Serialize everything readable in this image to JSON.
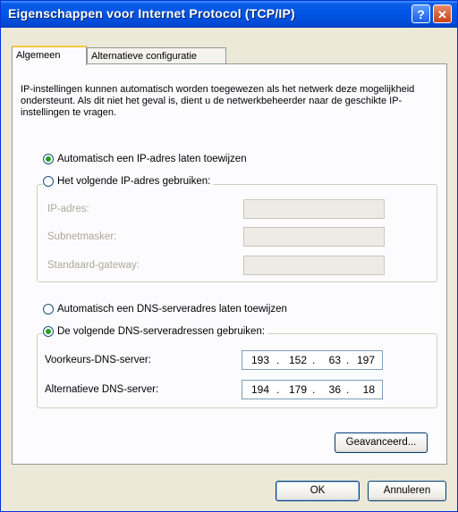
{
  "window": {
    "title": "Eigenschappen voor Internet Protocol (TCP/IP)",
    "help_glyph": "?",
    "close_glyph": "✕"
  },
  "tabs": [
    {
      "label": "Algemeen"
    },
    {
      "label": "Alternatieve configuratie"
    }
  ],
  "intro_text": "IP-instellingen kunnen automatisch worden toegewezen als het netwerk deze mogelijkheid ondersteunt. Als dit niet het geval is, dient u de netwerkbeheerder naar de geschikte IP-instellingen te vragen.",
  "ip": {
    "auto_label": "Automatisch een IP-adres laten toewijzen",
    "manual_label": "Het volgende IP-adres gebruiken:",
    "selected": "auto",
    "fields": [
      {
        "label": "IP-adres:",
        "value": ""
      },
      {
        "label": "Subnetmasker:",
        "value": ""
      },
      {
        "label": "Standaard-gateway:",
        "value": ""
      }
    ]
  },
  "dns": {
    "auto_label": "Automatisch een DNS-serveradres laten toewijzen",
    "manual_label": "De volgende DNS-serveradressen gebruiken:",
    "selected": "manual",
    "preferred": {
      "label": "Voorkeurs-DNS-server:",
      "octets": [
        "193",
        "152",
        "63",
        "197"
      ]
    },
    "alternate": {
      "label": "Alternatieve DNS-server:",
      "octets": [
        "194",
        "179",
        "36",
        "18"
      ]
    }
  },
  "buttons": {
    "advanced": "Geavanceerd...",
    "ok": "OK",
    "cancel": "Annuleren"
  },
  "colors": {
    "titlebar": "#0055e5",
    "dialog_bg": "#ece9d8",
    "radio_dot": "#21a121",
    "tab_highlight": "#ffc83c"
  }
}
